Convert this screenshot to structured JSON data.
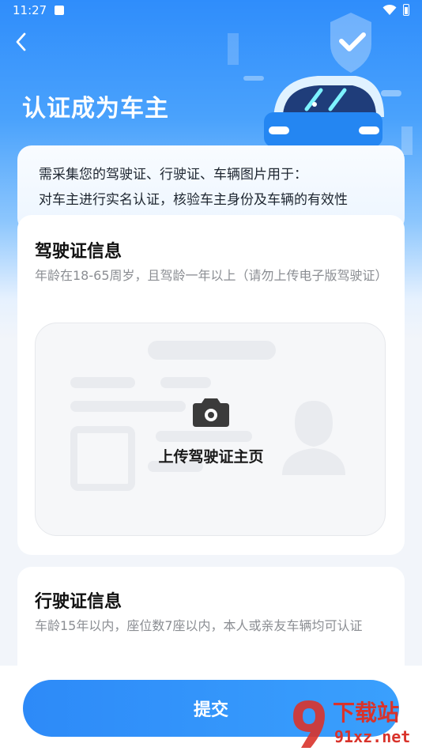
{
  "status_bar": {
    "time": "11:27",
    "icons": [
      "a-app-icon",
      "wifi-icon",
      "battery-icon"
    ]
  },
  "header": {
    "title": "认证成为车主",
    "back_icon": "chevron-left-icon"
  },
  "intro": {
    "line1": "需采集您的驾驶证、行驶证、车辆图片用于：",
    "line2": "对车主进行实名认证，核验车主身份及车辆的有效性"
  },
  "license_section": {
    "title": "驾驶证信息",
    "description": "年龄在18-65周岁，且驾龄一年以上（请勿上传电子版驾驶证）",
    "upload_label": "上传驾驶证主页",
    "upload_icon": "camera-icon"
  },
  "vehicle_section": {
    "title": "行驶证信息",
    "description": "车龄15年以内，座位数7座以内，本人或亲友车辆均可认证"
  },
  "submit_label": "提交",
  "watermark": {
    "brand": "下载站",
    "url": "91xz.net"
  },
  "colors": {
    "primary": "#2f8dfb",
    "title_text": "#111111",
    "desc_text": "#8b8e93",
    "watermark": "#d9332b"
  }
}
